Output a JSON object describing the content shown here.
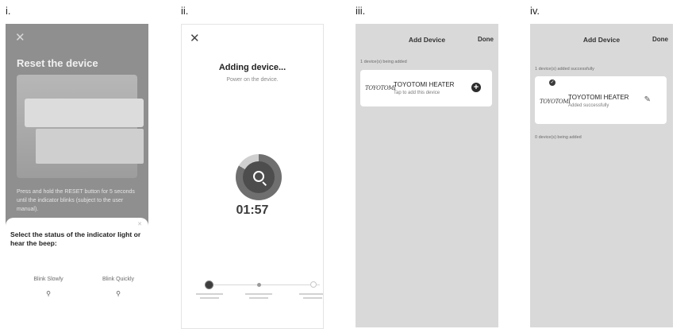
{
  "panels": {
    "labels": [
      "i.",
      "ii.",
      "iii.",
      "iv."
    ]
  },
  "colors": {
    "overlay_gray": "#8f8f8f",
    "list_background": "#d9d9d9",
    "card_background": "#ffffff",
    "progress_ring": "#6f6f6f"
  },
  "icons": {
    "close": "close-icon",
    "search": "search-icon",
    "add": "plus-circle-icon",
    "edit": "edit-icon",
    "success": "check-badge-icon"
  },
  "screen1": {
    "close_glyph": "✕",
    "title": "Reset the device",
    "instructions": "Press and hold the RESET button for 5 seconds until the indicator blinks (subject to the user manual).",
    "sheet": {
      "close_glyph": "✕",
      "question": "Select the status of the indicator light or hear the beep:",
      "option_slow": "Blink Slowly",
      "option_quick": "Blink Quickly"
    }
  },
  "screen2": {
    "close_glyph": "✕",
    "title": "Adding device...",
    "subtitle": "Power on the device.",
    "timer": "01:57"
  },
  "screen3": {
    "nav_title": "Add Device",
    "nav_done": "Done",
    "status": "1 device(s) being added",
    "device": {
      "logo": "TOYOTOMI",
      "name": "TOYOTOMI HEATER",
      "subtitle": "Tap to add this device"
    }
  },
  "screen4": {
    "nav_title": "Add Device",
    "nav_done": "Done",
    "status_success": "1 device(s) added successfully",
    "device": {
      "logo": "TOYOTOMI",
      "name": "TOYOTOMI HEATER",
      "subtitle": "Added successfully"
    },
    "status_pending": "0 device(s) being added"
  }
}
